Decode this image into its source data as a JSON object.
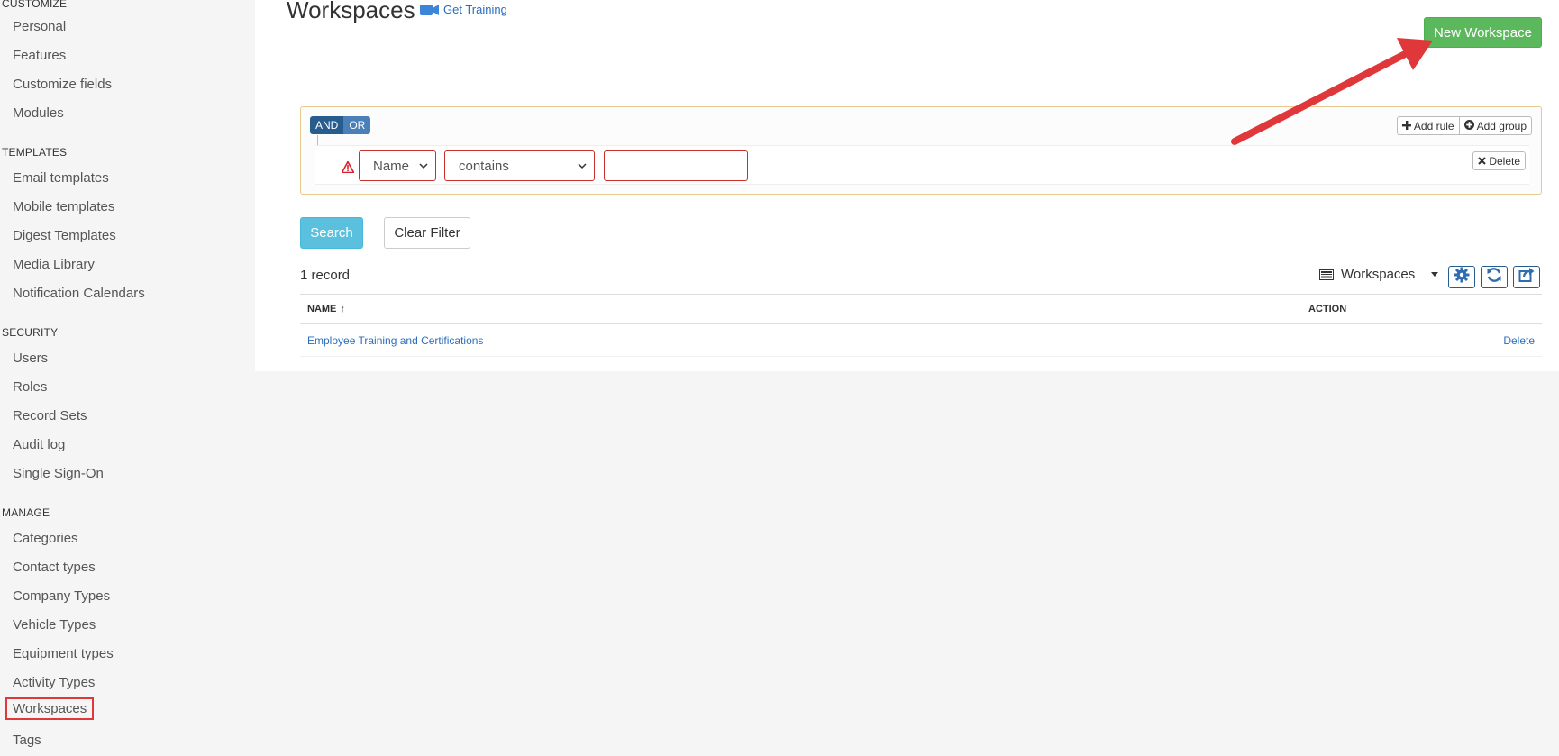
{
  "sidebar": {
    "sections": [
      {
        "title": "CUSTOMIZE",
        "items": [
          "Personal",
          "Features",
          "Customize fields",
          "Modules"
        ]
      },
      {
        "title": "TEMPLATES",
        "items": [
          "Email templates",
          "Mobile templates",
          "Digest Templates",
          "Media Library",
          "Notification Calendars"
        ]
      },
      {
        "title": "SECURITY",
        "items": [
          "Users",
          "Roles",
          "Record Sets",
          "Audit log",
          "Single Sign-On"
        ]
      },
      {
        "title": "MANAGE",
        "items": [
          "Categories",
          "Contact types",
          "Company Types",
          "Vehicle Types",
          "Equipment types",
          "Activity Types",
          "Workspaces",
          "Tags"
        ]
      }
    ],
    "active_item": "Workspaces"
  },
  "header": {
    "title": "Workspaces",
    "get_training": "Get Training",
    "new_button": "New Workspace"
  },
  "query_builder": {
    "and_label": "AND",
    "or_label": "OR",
    "add_rule": "Add rule",
    "add_group": "Add group",
    "field_value": "Name",
    "operator_value": "contains",
    "value_input": "",
    "delete_label": "Delete"
  },
  "actions": {
    "search": "Search",
    "clear_filter": "Clear Filter"
  },
  "results": {
    "count_text": "1 record",
    "view_name": "Workspaces",
    "columns": [
      "NAME",
      "ACTION"
    ],
    "sort_indicator": "↑",
    "rows": [
      {
        "name": "Employee Training and Certifications",
        "action": "Delete"
      }
    ]
  },
  "colors": {
    "primary_green": "#5cb85c",
    "info_blue": "#5bc0de",
    "link_blue": "#2a6ebd",
    "error_red": "#c9302c",
    "annotation_red": "#e0373a"
  }
}
